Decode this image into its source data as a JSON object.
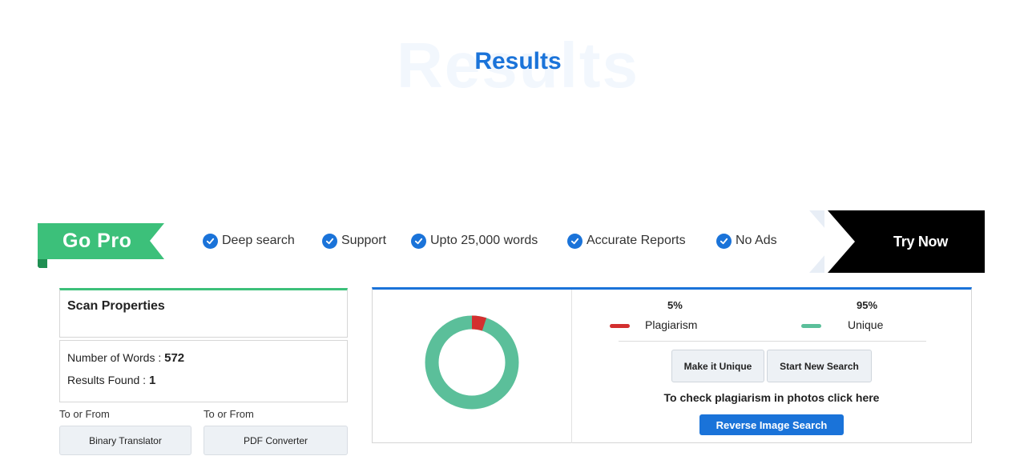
{
  "header": {
    "title": "Results",
    "title_watermark": "Results"
  },
  "promo": {
    "badge": "Go Pro",
    "features": [
      "Deep search",
      "Support",
      "Upto 25,000 words",
      "Accurate Reports",
      "No Ads"
    ],
    "cta": "Try Now",
    "colors": {
      "badge": "#3cc07a",
      "check": "#1a73d9",
      "cta_bg": "#000000"
    }
  },
  "scan": {
    "title": "Scan Properties",
    "words_label": "Number of Words :",
    "words_value": "572",
    "results_label": "Results Found :",
    "results_value": "1"
  },
  "tools": [
    {
      "caption": "To or From",
      "label": "Binary Translator"
    },
    {
      "caption": "To or From",
      "label": "PDF Converter"
    }
  ],
  "result": {
    "plagiarism_pct_text": "5%",
    "unique_pct_text": "95%",
    "plagiarism_fraction": 0.05,
    "plagiarism_label": "Plagiarism",
    "unique_label": "Unique",
    "colors": {
      "plagiarism": "#d32f2f",
      "unique": "#5bbf9a"
    },
    "make_unique": "Make it Unique",
    "new_search": "Start New Search",
    "photo_text": "To check plagiarism in photos click here",
    "reverse_search": "Reverse Image Search"
  }
}
